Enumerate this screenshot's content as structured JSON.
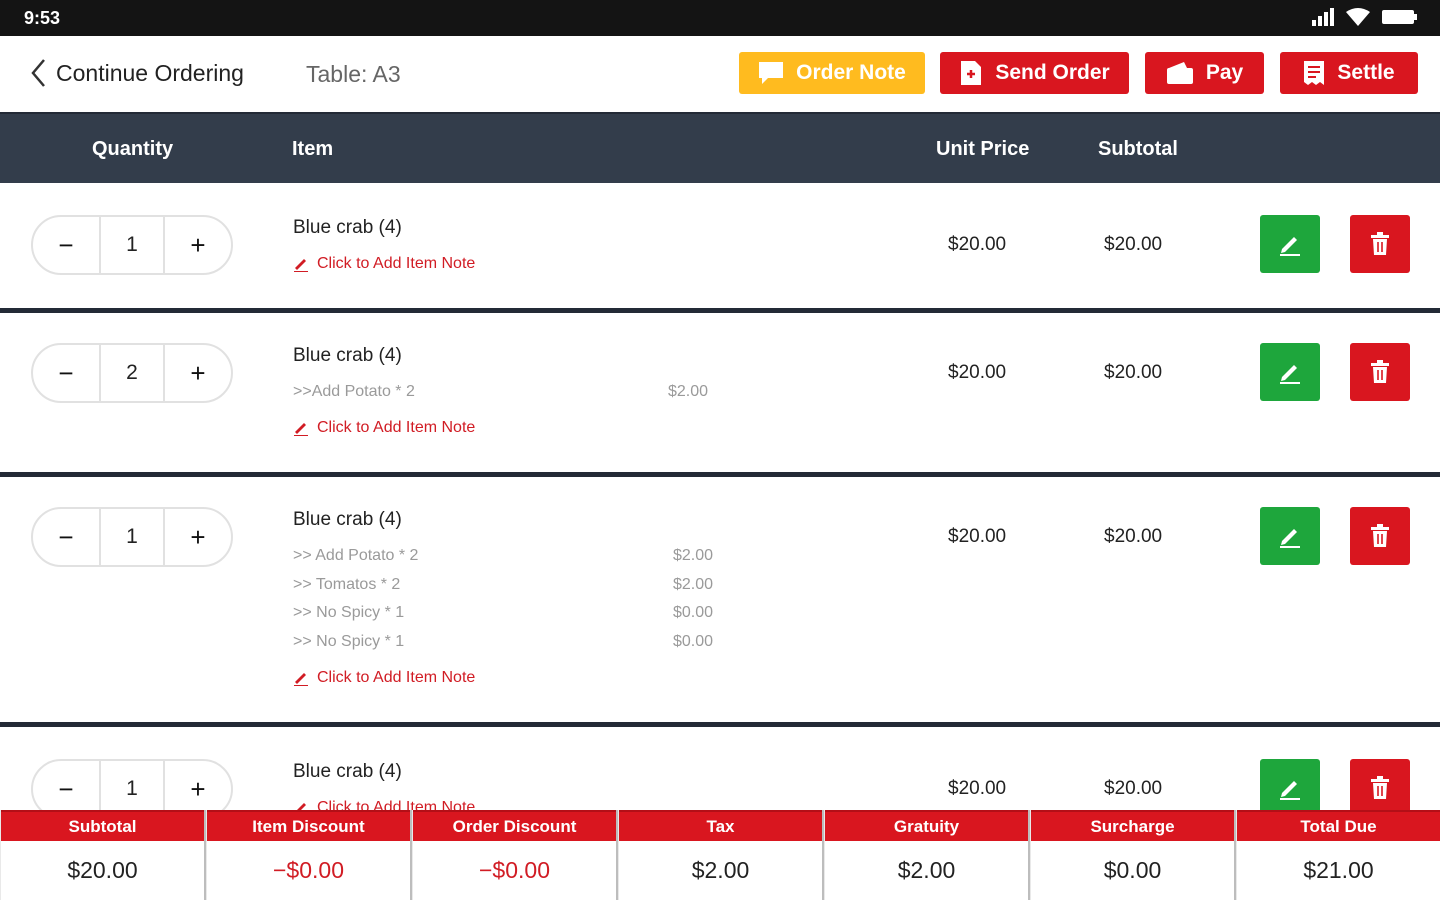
{
  "status": {
    "time": "9:53",
    "icons": [
      "signal-icon",
      "wifi-icon",
      "battery-icon"
    ]
  },
  "topbar": {
    "back_label": "Continue Ordering",
    "table_label": "Table: A3",
    "order_note": "Order Note",
    "send_order": "Send Order",
    "pay": "Pay",
    "settle": "Settle"
  },
  "header": {
    "quantity": "Quantity",
    "item": "Item",
    "unit_price": "Unit Price",
    "subtotal": "Subtotal"
  },
  "rows": [
    {
      "qty": "1",
      "name": "Blue crab (4)",
      "modifiers": [],
      "note": "Click to Add Item Note",
      "unit_price": "$20.00",
      "subtotal": "$20.00"
    },
    {
      "qty": "2",
      "name": "Blue crab (4)",
      "modifiers": [
        {
          "label": ">>Add Potato * 2",
          "price": "$2.00"
        }
      ],
      "note": "Click to Add Item Note",
      "unit_price": "$20.00",
      "subtotal": "$20.00"
    },
    {
      "qty": "1",
      "name": "Blue crab (4)",
      "modifiers": [
        {
          "label": ">> Add Potato * 2",
          "price": "$2.00"
        },
        {
          "label": ">> Tomatos * 2",
          "price": "$2.00"
        },
        {
          "label": ">> No Spicy * 1",
          "price": "$0.00"
        },
        {
          "label": ">> No Spicy * 1",
          "price": "$0.00"
        }
      ],
      "note": "Click to Add Item Note",
      "unit_price": "$20.00",
      "subtotal": "$20.00"
    },
    {
      "qty": "1",
      "name": "Blue crab (4)",
      "modifiers": [],
      "note": "Click to Add Item Note",
      "unit_price": "$20.00",
      "subtotal": "$20.00"
    }
  ],
  "stepper": {
    "minus": "−",
    "plus": "+"
  },
  "footer": [
    {
      "label": "Subtotal",
      "value": "$20.00"
    },
    {
      "label": "Item Discount",
      "value": "−$0.00"
    },
    {
      "label": "Order Discount",
      "value": "−$0.00"
    },
    {
      "label": "Tax",
      "value": "$2.00"
    },
    {
      "label": "Gratuity",
      "value": "$2.00"
    },
    {
      "label": "Surcharge",
      "value": "$0.00"
    },
    {
      "label": "Total Due",
      "value": "$21.00"
    }
  ],
  "colors": {
    "accent_red": "#d9161f",
    "note_yellow": "#ffbb1f",
    "edit_green": "#1ea63c",
    "header_dark": "#333d4b"
  }
}
